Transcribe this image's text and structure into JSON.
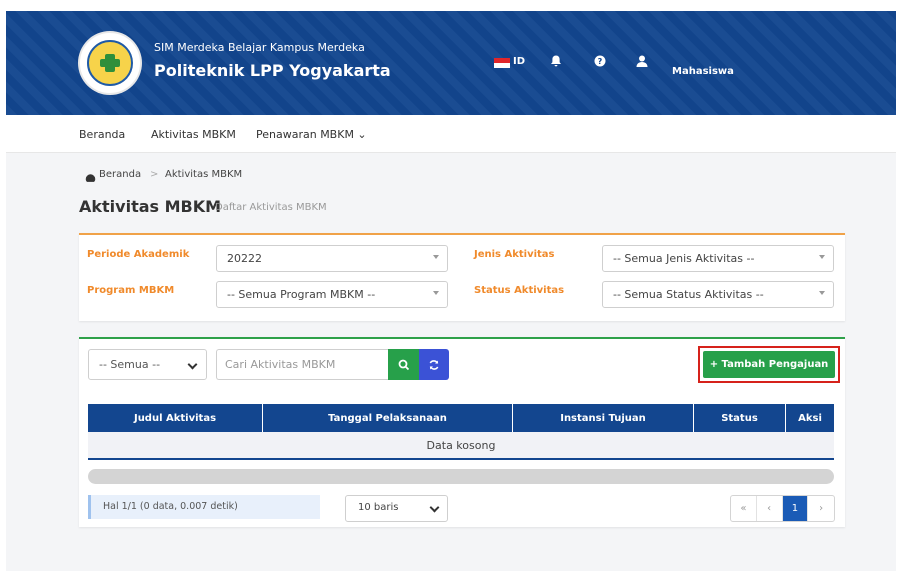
{
  "header": {
    "subtitle": "SIM Merdeka Belajar Kampus Merdeka",
    "title": "Politeknik LPP Yogyakarta",
    "lang": "ID",
    "role": "Mahasiswa",
    "logo_text": "POLITEKNIK LPP YOGYAKARTA"
  },
  "nav": {
    "items": [
      {
        "label": "Beranda"
      },
      {
        "label": "Aktivitas MBKM"
      },
      {
        "label": "Penawaran MBKM ⌄"
      }
    ]
  },
  "breadcrumb": {
    "home": "Beranda",
    "separator": ">",
    "current": "Aktivitas MBKM"
  },
  "page": {
    "title": "Aktivitas MBKM",
    "subtitle": "Daftar Aktivitas MBKM"
  },
  "filters": {
    "periode_label": "Periode Akademik",
    "periode_value": "20222",
    "program_label": "Program MBKM",
    "program_value": "-- Semua Program MBKM --",
    "jenis_label": "Jenis Aktivitas",
    "jenis_value": "-- Semua Jenis Aktivitas --",
    "status_label": "Status Aktivitas",
    "status_value": "-- Semua Status Aktivitas --"
  },
  "toolbar": {
    "filter_select": "-- Semua --",
    "search_placeholder": "Cari Aktivitas MBKM",
    "add_label": "+ Tambah Pengajuan"
  },
  "table": {
    "columns": [
      "Judul Aktivitas",
      "Tanggal Pelaksanaan",
      "Instansi Tujuan",
      "Status",
      "Aksi"
    ],
    "empty_text": "Data kosong"
  },
  "footer": {
    "info": "Hal 1/1 (0 data, 0.007 detik)",
    "rows_select": "10 baris",
    "pager": [
      "«",
      "‹",
      "1",
      "›"
    ]
  },
  "colors": {
    "brand": "#13468f",
    "accent_orange": "#f08a2b",
    "success": "#27a04a",
    "highlight": "#d6221b"
  }
}
